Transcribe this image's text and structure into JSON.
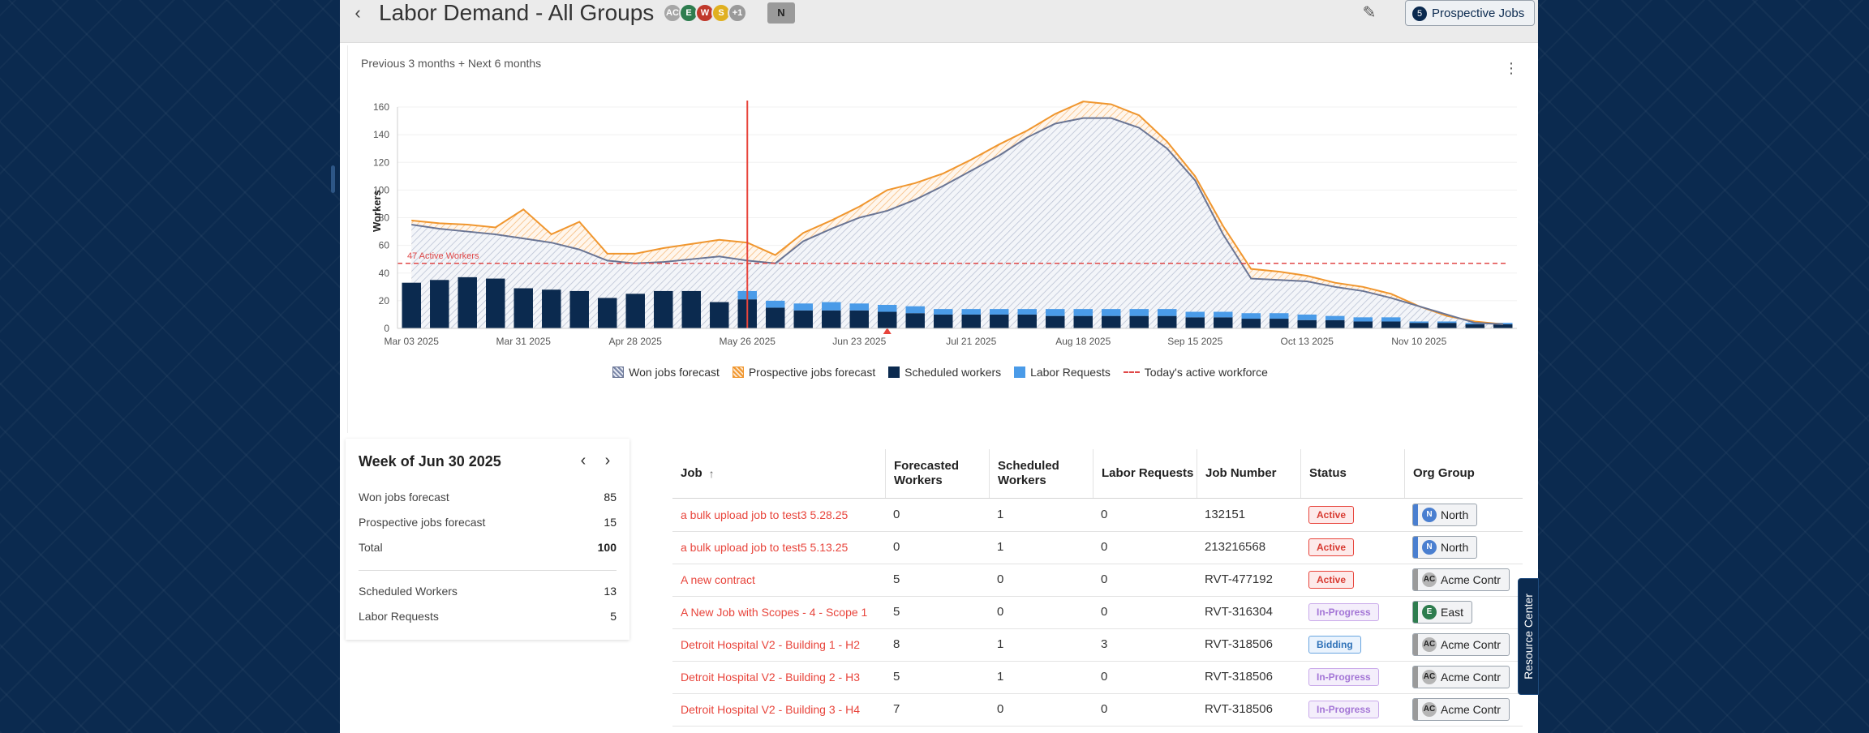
{
  "header": {
    "title": "Labor Demand - All Groups",
    "avatars": [
      {
        "initials": "AC",
        "color": "#a6a6a6"
      },
      {
        "initials": "E",
        "color": "#2e7d4f"
      },
      {
        "initials": "W",
        "color": "#c0392b"
      },
      {
        "initials": "S",
        "color": "#e0b020"
      },
      {
        "initials": "+1",
        "color": "#9a9a9a"
      }
    ],
    "filter_badge": "N",
    "prospective_count": "5",
    "prospective_label": "Prospective Jobs"
  },
  "chart": {
    "range_label": "Previous 3 months + Next 6 months",
    "today_label": "47 Active Workers",
    "legend": {
      "won": "Won jobs forecast",
      "prospective": "Prospective jobs forecast",
      "scheduled": "Scheduled workers",
      "labor": "Labor Requests",
      "today": "Today's active workforce"
    }
  },
  "chart_data": {
    "type": "bar",
    "ylabel": "Workers",
    "ylim": [
      0,
      160
    ],
    "yticks": [
      0,
      20,
      40,
      60,
      80,
      100,
      120,
      140,
      160
    ],
    "xtick_labels": [
      "Mar 03 2025",
      "Mar 31 2025",
      "Apr 28 2025",
      "May 26 2025",
      "Jun 23 2025",
      "Jul 21 2025",
      "Aug 18 2025",
      "Sep 15 2025",
      "Oct 13 2025",
      "Nov 10 2025"
    ],
    "xtick_indices": [
      0,
      4,
      8,
      12,
      16,
      20,
      24,
      28,
      32,
      36
    ],
    "scheduled_workers": [
      33,
      35,
      37,
      36,
      29,
      28,
      27,
      22,
      25,
      27,
      27,
      19,
      21,
      15,
      13,
      13,
      13,
      12,
      11,
      10,
      10,
      10,
      10,
      9,
      9,
      9,
      9,
      9,
      8,
      8,
      7,
      7,
      6,
      6,
      5,
      5,
      4,
      4,
      3,
      3
    ],
    "labor_requests": [
      0,
      0,
      0,
      0,
      0,
      0,
      0,
      0,
      0,
      0,
      0,
      0,
      6,
      5,
      5,
      6,
      5,
      5,
      5,
      4,
      4,
      4,
      4,
      5,
      5,
      5,
      5,
      5,
      4,
      4,
      4,
      4,
      4,
      3,
      3,
      3,
      1,
      1,
      1,
      1
    ],
    "won_jobs_forecast": [
      75,
      72,
      70,
      68,
      65,
      62,
      57,
      49,
      47,
      48,
      50,
      52,
      49,
      47,
      63,
      72,
      80,
      85,
      93,
      103,
      114,
      125,
      138,
      148,
      152,
      152,
      145,
      130,
      107,
      68,
      36,
      35,
      34,
      30,
      27,
      22,
      16,
      10,
      4,
      3
    ],
    "prospective_jobs_forecast": [
      78,
      76,
      75,
      73,
      86,
      68,
      77,
      54,
      54,
      58,
      61,
      64,
      62,
      53,
      69,
      78,
      88,
      100,
      105,
      112,
      122,
      133,
      143,
      155,
      164,
      162,
      154,
      135,
      110,
      74,
      43,
      41,
      38,
      33,
      30,
      25,
      16,
      9,
      5,
      3
    ],
    "today_active_workforce": 47,
    "today_index": 12.5,
    "selected_week_index": 17
  },
  "week_panel": {
    "title": "Week of Jun 30 2025",
    "rows": [
      {
        "label": "Won jobs forecast",
        "value": "85"
      },
      {
        "label": "Prospective jobs forecast",
        "value": "15"
      },
      {
        "label": "Total",
        "value": "100"
      },
      {
        "label": "Scheduled Workers",
        "value": "13"
      },
      {
        "label": "Labor Requests",
        "value": "5"
      }
    ]
  },
  "table": {
    "columns": {
      "job": "Job",
      "forecasted": "Forecasted Workers",
      "scheduled": "Scheduled Workers",
      "labor": "Labor Requests",
      "number": "Job Number",
      "status": "Status",
      "org": "Org Group"
    },
    "rows": [
      {
        "job": "a bulk upload job to test3 5.28.25",
        "forecasted": "0",
        "scheduled": "1",
        "labor": "0",
        "number": "132151",
        "status": "Active",
        "org_initial": "N",
        "org": "North"
      },
      {
        "job": "a bulk upload job to test5 5.13.25",
        "forecasted": "0",
        "scheduled": "1",
        "labor": "0",
        "number": "213216568",
        "status": "Active",
        "org_initial": "N",
        "org": "North"
      },
      {
        "job": "A new contract",
        "forecasted": "5",
        "scheduled": "0",
        "labor": "0",
        "number": "RVT-477192",
        "status": "Active",
        "org_initial": "AC",
        "org": "Acme Contr"
      },
      {
        "job": "A New Job with Scopes - 4 - Scope 1",
        "forecasted": "5",
        "scheduled": "0",
        "labor": "0",
        "number": "RVT-316304",
        "status": "In-Progress",
        "org_initial": "E",
        "org": "East"
      },
      {
        "job": "Detroit Hospital V2 - Building 1 - H2",
        "forecasted": "8",
        "scheduled": "1",
        "labor": "3",
        "number": "RVT-318506",
        "status": "Bidding",
        "org_initial": "AC",
        "org": "Acme Contr"
      },
      {
        "job": "Detroit Hospital V2 - Building 2 - H3",
        "forecasted": "5",
        "scheduled": "1",
        "labor": "0",
        "number": "RVT-318506",
        "status": "In-Progress",
        "org_initial": "AC",
        "org": "Acme Contr"
      },
      {
        "job": "Detroit Hospital V2 - Building 3 - H4",
        "forecasted": "7",
        "scheduled": "0",
        "labor": "0",
        "number": "RVT-318506",
        "status": "In-Progress",
        "org_initial": "AC",
        "org": "Acme Contr"
      }
    ]
  },
  "resource_center": "Resource Center",
  "colors": {
    "navy": "#0b2a4f",
    "labor_blue": "#4a9be8",
    "prospective_orange": "#f0962e",
    "won_slate": "#6a7594",
    "today_red": "#e04848"
  }
}
